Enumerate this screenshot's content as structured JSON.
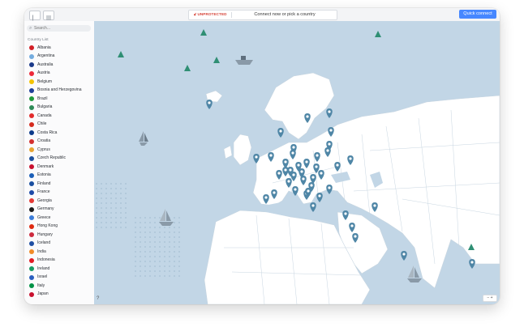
{
  "header": {
    "status": "UNPROTECTED",
    "connect_prompt": "Connect now or pick a country",
    "quick_connect": "Quick connect"
  },
  "search": {
    "placeholder": "Search..."
  },
  "sidebar": {
    "title": "Country List",
    "countries": [
      {
        "name": "Albania",
        "color": "#d21f26"
      },
      {
        "name": "Argentina",
        "color": "#74acdf"
      },
      {
        "name": "Australia",
        "color": "#1b3a8a"
      },
      {
        "name": "Austria",
        "color": "#ed2939"
      },
      {
        "name": "Belgium",
        "color": "#f4c300"
      },
      {
        "name": "Bosnia and Herzegovina",
        "color": "#1f3f98"
      },
      {
        "name": "Brazil",
        "color": "#1f9a3b"
      },
      {
        "name": "Bulgaria",
        "color": "#2e8b57"
      },
      {
        "name": "Canada",
        "color": "#e22b2b"
      },
      {
        "name": "Chile",
        "color": "#d52b1e"
      },
      {
        "name": "Costa Rica",
        "color": "#0c3a8a"
      },
      {
        "name": "Croatia",
        "color": "#d32f2f"
      },
      {
        "name": "Cyprus",
        "color": "#e8a530"
      },
      {
        "name": "Czech Republic",
        "color": "#1c4f9c"
      },
      {
        "name": "Denmark",
        "color": "#c8102e"
      },
      {
        "name": "Estonia",
        "color": "#1b5fb8"
      },
      {
        "name": "Finland",
        "color": "#1a4fa0"
      },
      {
        "name": "France",
        "color": "#1d4aa8"
      },
      {
        "name": "Georgia",
        "color": "#e53935"
      },
      {
        "name": "Germany",
        "color": "#1a1a1a"
      },
      {
        "name": "Greece",
        "color": "#3c7dd9"
      },
      {
        "name": "Hong Kong",
        "color": "#de2910"
      },
      {
        "name": "Hungary",
        "color": "#cd2a3e"
      },
      {
        "name": "Iceland",
        "color": "#1f4fa3"
      },
      {
        "name": "India",
        "color": "#f28c28"
      },
      {
        "name": "Indonesia",
        "color": "#e21b23"
      },
      {
        "name": "Ireland",
        "color": "#169b62"
      },
      {
        "name": "Israel",
        "color": "#2b5fbf"
      },
      {
        "name": "Italy",
        "color": "#009246"
      },
      {
        "name": "Japan",
        "color": "#c8102e"
      }
    ]
  },
  "map": {
    "water_color": "#c2d6e6",
    "land_color": "#ffffff",
    "pin_color": "#4f86a6",
    "tree_color": "#2f8f74",
    "pin_count": 46
  },
  "footer": {
    "help": "?",
    "zoom": "− +"
  }
}
